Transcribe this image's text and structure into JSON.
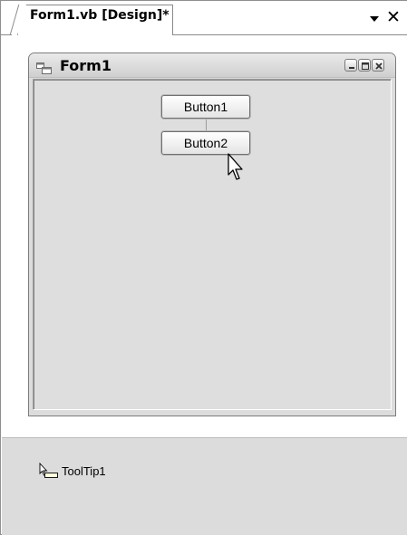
{
  "tab": {
    "title": "Form1.vb [Design]*",
    "dropdown_icon": "chevron-down-icon",
    "close_icon": "close-icon",
    "close_glyph": "✕"
  },
  "form": {
    "caption": "Form1",
    "icon": "form-window-icon",
    "caption_buttons": [
      "minimize-icon",
      "maximize-icon",
      "close-icon"
    ]
  },
  "controls": {
    "button1_label": "Button1",
    "button2_label": "Button2"
  },
  "tray": {
    "items": [
      {
        "label": "ToolTip1",
        "icon": "tooltip-component-icon"
      }
    ]
  },
  "colors": {
    "form_background": "#dcdcdc",
    "tray_background": "#dcdcdc",
    "surface_background": "#ffffff"
  }
}
